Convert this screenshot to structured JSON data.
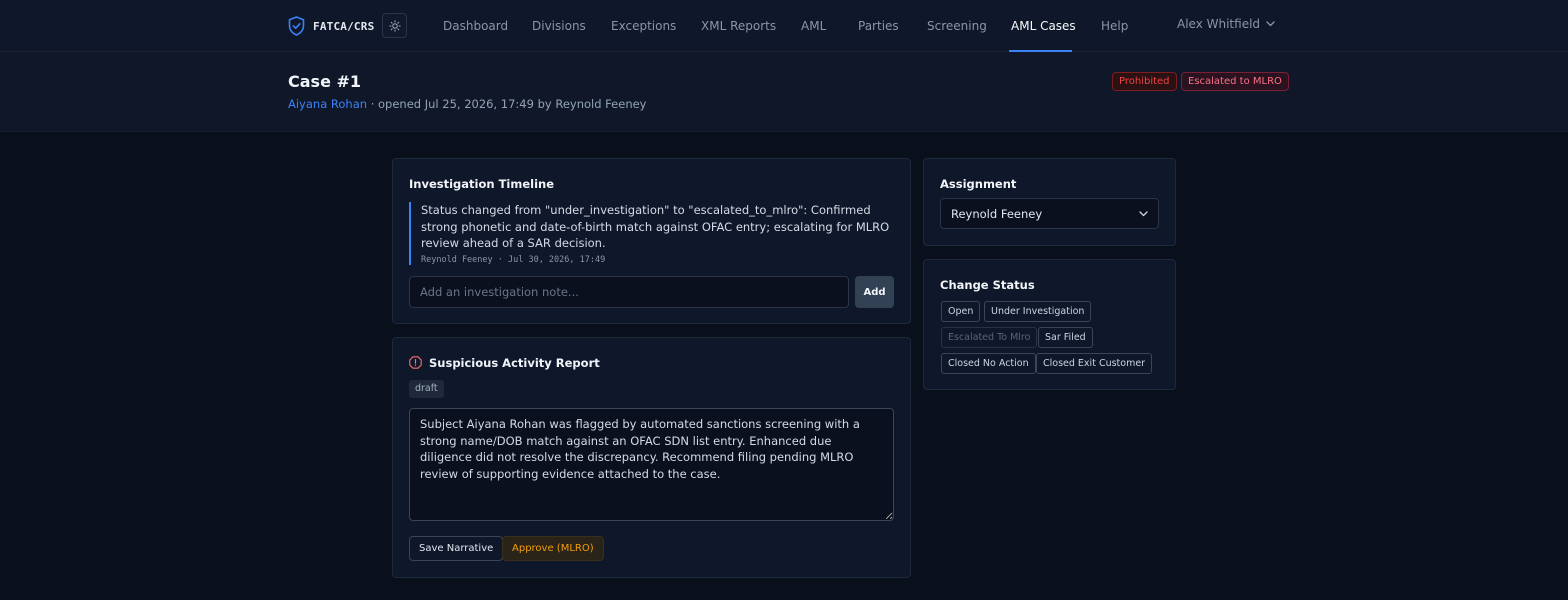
{
  "brand": {
    "name": "FATCA/CRS"
  },
  "nav": {
    "items": [
      {
        "label": "Dashboard"
      },
      {
        "label": "Divisions"
      },
      {
        "label": "Exceptions"
      },
      {
        "label": "XML Reports"
      },
      {
        "label": "AML"
      },
      {
        "label": "Parties"
      },
      {
        "label": "Screening"
      },
      {
        "label": "AML Cases"
      },
      {
        "label": "Help"
      }
    ],
    "active": "AML Cases",
    "user": "Alex Whitfield"
  },
  "case": {
    "title": "Case #1",
    "party": "Aiyana Rohan",
    "opened_text": "· opened Jul 25, 2026, 17:49 by Reynold Feeney",
    "badges": [
      "Prohibited",
      "Escalated to MLRO"
    ]
  },
  "timeline": {
    "title": "Investigation Timeline",
    "entries": [
      {
        "text": "Status changed from \"under_investigation\" to \"escalated_to_mlro\": Confirmed strong phonetic and date-of-birth match against OFAC entry; escalating for MLRO review ahead of a SAR decision.",
        "meta": "Reynold Feeney · Jul 30, 2026, 17:49"
      }
    ],
    "note_placeholder": "Add an investigation note...",
    "add_label": "Add"
  },
  "sar": {
    "title": "Suspicious Activity Report",
    "status": "draft",
    "narrative": "Subject Aiyana Rohan was flagged by automated sanctions screening with a strong name/DOB match against an OFAC SDN list entry. Enhanced due diligence did not resolve the discrepancy. Recommend filing pending MLRO review of supporting evidence attached to the case.",
    "save_label": "Save Narrative",
    "approve_label": "Approve (MLRO)"
  },
  "assignment": {
    "title": "Assignment",
    "selected": "Reynold Feeney"
  },
  "change_status": {
    "title": "Change Status",
    "options": [
      {
        "label": "Open",
        "disabled": false
      },
      {
        "label": "Under Investigation",
        "disabled": false
      },
      {
        "label": "Escalated To Mlro",
        "disabled": true
      },
      {
        "label": "Sar Filed",
        "disabled": false
      },
      {
        "label": "Closed No Action",
        "disabled": false
      },
      {
        "label": "Closed Exit Customer",
        "disabled": false
      }
    ]
  },
  "colors": {
    "accent": "#3b82f6",
    "danger": "#ef4444",
    "warning": "#f59e0b",
    "background": "#0a0f1c",
    "surface": "#0f172a"
  },
  "icons": {
    "brand": "shield-check-icon",
    "theme": "sun-icon",
    "user_menu": "chevron-down-icon",
    "sar": "alert-octagon-icon",
    "select": "chevron-down-icon"
  }
}
